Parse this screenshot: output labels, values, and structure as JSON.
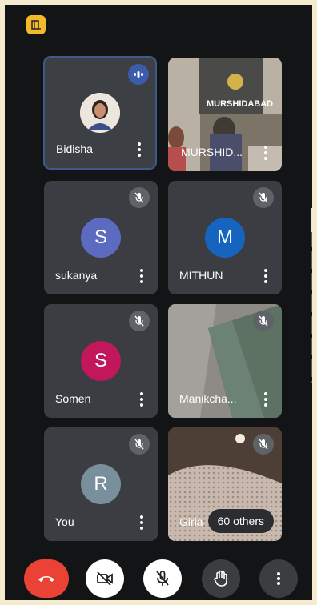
{
  "participants": [
    {
      "name": "Bidisha",
      "initial": "",
      "color": "#e8dccf",
      "state": "speaking"
    },
    {
      "name": "MURSHID...",
      "initial": "",
      "color": "#6d6a62",
      "state": "video",
      "video_caption": "MURSHIDABAD"
    },
    {
      "name": "sukanya",
      "initial": "S",
      "color": "#5c6bc0",
      "state": "muted"
    },
    {
      "name": "MITHUN",
      "initial": "M",
      "color": "#1565c0",
      "state": "muted"
    },
    {
      "name": "Somen",
      "initial": "S",
      "color": "#c2185b",
      "state": "muted"
    },
    {
      "name": "Manikcha...",
      "initial": "",
      "color": "#7a8279",
      "state": "video-muted"
    },
    {
      "name": "You",
      "initial": "R",
      "color": "#78909c",
      "state": "muted"
    },
    {
      "name": "Giria",
      "initial": "",
      "color": "#b7a79a",
      "state": "video-muted"
    }
  ],
  "others_label": "60 others",
  "controls": {
    "end_call": "call-end-icon",
    "camera": "videocam-off-icon",
    "mic": "mic-off-icon",
    "hand": "raise-hand-icon",
    "more": "more-vert-icon"
  },
  "colors": {
    "end_call": "#ea4335",
    "accent_badge": "#f3b928",
    "speaking_badge": "#3c5bab"
  }
}
